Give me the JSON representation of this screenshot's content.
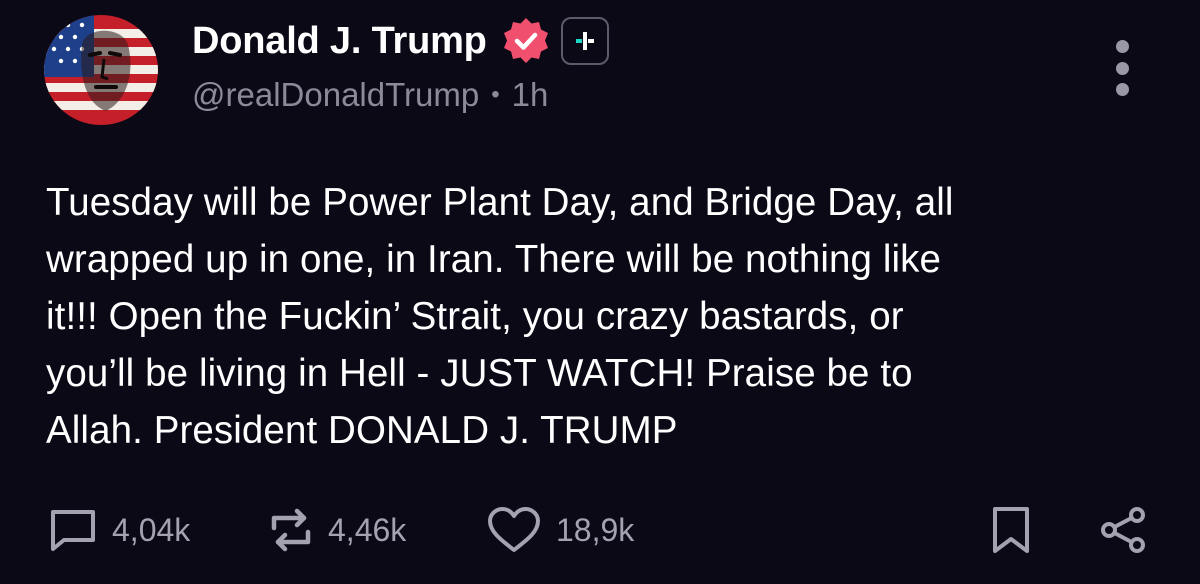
{
  "author": {
    "display_name": "Donald J. Trump",
    "handle": "@realDonaldTrump",
    "time": "1h",
    "separator": "•",
    "verified_color": "#f0506e",
    "plus_accent": "#1fd6c4"
  },
  "post": {
    "text": "Tuesday will be Power Plant Day, and Bridge Day, all\nwrapped up in one, in Iran. There will be nothing like\nit!!! Open the Fuckin’ Strait, you crazy bastards, or\nyou’ll be living in Hell - JUST WATCH! Praise be to\nAllah. President DONALD J. TRUMP"
  },
  "actions": {
    "replies": "4,04k",
    "reposts": "4,46k",
    "likes": "18,9k"
  },
  "theme": {
    "background": "#0b0916",
    "muted_text": "#8c8a98",
    "icon_color": "#a4a2b0"
  }
}
